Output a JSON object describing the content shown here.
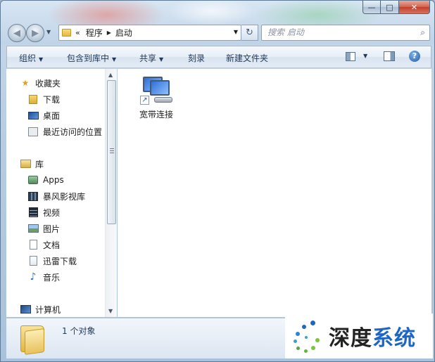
{
  "window": {
    "caption_min": "—",
    "caption_max": "□",
    "caption_close": "✕"
  },
  "nav": {
    "back_icon": "◀",
    "forward_icon": "▶",
    "recent_icon": "▼",
    "address_chevron": "«",
    "breadcrumb": [
      "程序",
      "启动"
    ],
    "breadcrumb_sep": "▶",
    "address_dropdown": "▼",
    "refresh_icon": "↻",
    "search_placeholder": "搜索 启动",
    "search_icon": "⌕"
  },
  "toolbar": {
    "items": [
      {
        "label": "组织",
        "has_arrow": true
      },
      {
        "label": "包含到库中",
        "has_arrow": true
      },
      {
        "label": "共享",
        "has_arrow": true
      },
      {
        "label": "刻录",
        "has_arrow": false
      },
      {
        "label": "新建文件夹",
        "has_arrow": false
      }
    ],
    "arrow": "▼",
    "view_arrow": "▼",
    "help": "?"
  },
  "sidebar": {
    "favorites": {
      "label": "收藏夹",
      "icon": "star-icon"
    },
    "favorites_items": [
      {
        "label": "下载",
        "icon": "download-folder-icon"
      },
      {
        "label": "桌面",
        "icon": "desktop-icon"
      },
      {
        "label": "最近访问的位置",
        "icon": "recent-places-icon"
      }
    ],
    "libraries": {
      "label": "库",
      "icon": "library-icon"
    },
    "library_items": [
      {
        "label": "Apps",
        "icon": "apps-icon"
      },
      {
        "label": "暴风影视库",
        "icon": "media-library-icon"
      },
      {
        "label": "视频",
        "icon": "video-icon"
      },
      {
        "label": "图片",
        "icon": "picture-icon"
      },
      {
        "label": "文档",
        "icon": "document-icon"
      },
      {
        "label": "迅雷下载",
        "icon": "thunder-download-icon"
      },
      {
        "label": "音乐",
        "icon": "music-icon"
      }
    ],
    "computer": {
      "label": "计算机",
      "icon": "computer-icon"
    },
    "scroll_up": "▲",
    "scroll_down": "▼"
  },
  "main": {
    "files": [
      {
        "label": "宽带连接",
        "icon": "network-connection-shortcut-icon"
      }
    ],
    "shortcut_arrow": "↗"
  },
  "details": {
    "count": "1 个对象"
  },
  "watermark": {
    "text_a": "深度",
    "text_b": "系统"
  }
}
